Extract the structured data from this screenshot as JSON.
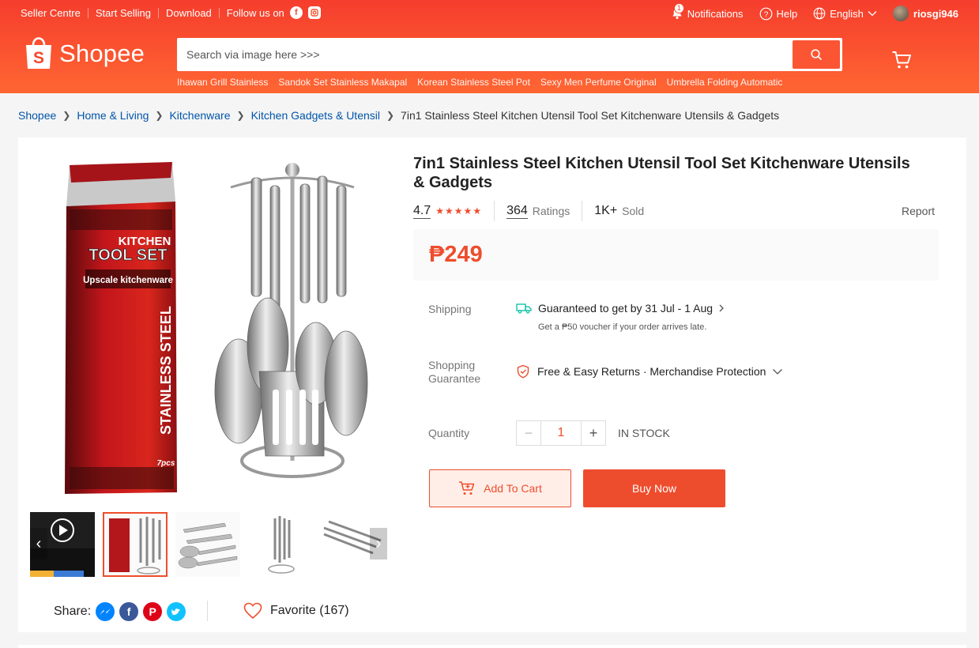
{
  "topnav": {
    "seller_centre": "Seller Centre",
    "start_selling": "Start Selling",
    "download": "Download",
    "follow_us": "Follow us on",
    "notifications": "Notifications",
    "notification_count": "1",
    "help": "Help",
    "language": "English",
    "username": "riosgi946"
  },
  "logo": {
    "text": "Shopee"
  },
  "search": {
    "placeholder": "Search via image here >>>",
    "suggestions": [
      "Ihawan Grill Stainless",
      "Sandok Set Stainless Makapal",
      "Korean Stainless Steel Pot",
      "Sexy Men Perfume Original",
      "Umbrella Folding Automatic"
    ]
  },
  "breadcrumb": {
    "items": [
      "Shopee",
      "Home & Living",
      "Kitchenware",
      "Kitchen Gadgets & Utensil"
    ],
    "current": "7in1 Stainless Steel Kitchen Utensil Tool Set Kitchenware Utensils & Gadgets"
  },
  "product": {
    "title": "7in1 Stainless Steel Kitchen Utensil Tool Set Kitchenware Utensils & Gadgets",
    "rating": "4.7",
    "rating_value": 4.7,
    "ratings_count": "364",
    "ratings_label": "Ratings",
    "sold_count": "1K+",
    "sold_label": "Sold",
    "report": "Report",
    "price": "₱249",
    "box_text": {
      "brand_line1": "KITCHEN",
      "brand_line2": "TOOL SET",
      "tagline": "Upscale kitchenware",
      "side": "STAINLESS STEEL",
      "pieces": "7pcs"
    }
  },
  "shipping": {
    "label": "Shipping",
    "guarantee": "Guaranteed to get by 31 Jul - 1 Aug",
    "voucher": "Get a ₱50 voucher if your order arrives late."
  },
  "guarantee": {
    "label_line1": "Shopping",
    "label_line2": "Guarantee",
    "text": "Free & Easy Returns · Merchandise Protection"
  },
  "quantity": {
    "label": "Quantity",
    "value": "1",
    "stock": "IN STOCK"
  },
  "actions": {
    "add_to_cart": "Add To Cart",
    "buy_now": "Buy Now"
  },
  "share": {
    "label": "Share:",
    "favorite": "Favorite (167)"
  },
  "colors": {
    "brand": "#ee4d2d",
    "link": "#0055aa"
  }
}
